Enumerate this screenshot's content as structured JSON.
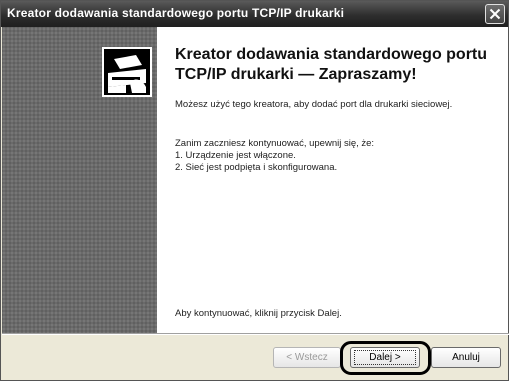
{
  "window": {
    "title": "Kreator dodawania standardowego portu TCP/IP drukarki"
  },
  "content": {
    "heading": "Kreator dodawania standardowego portu TCP/IP drukarki — Zapraszamy!",
    "intro": "Możesz użyć tego kreatora, aby dodać port dla drukarki sieciowej.",
    "before_label": "Zanim zaczniesz kontynuować, upewnij się, że:",
    "items": [
      "1.  Urządzenie jest włączone.",
      "2.  Sieć jest podpięta i skonfigurowana."
    ],
    "continue_hint": "Aby kontynuować, kliknij przycisk Dalej."
  },
  "buttons": {
    "back": "< Wstecz",
    "next": "Dalej >",
    "cancel": "Anuluj"
  },
  "icons": {
    "close": "close-icon",
    "wizard": "printer-port-icon"
  }
}
